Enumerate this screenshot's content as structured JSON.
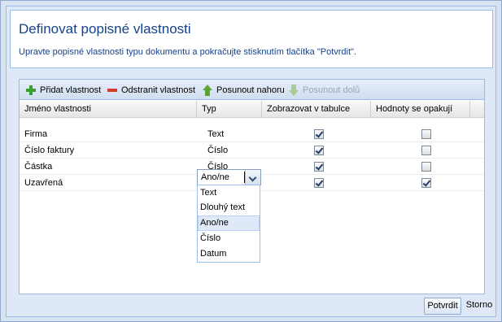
{
  "dialog": {
    "title": "Definovat popisné vlastnosti",
    "description": "Upravte popisné vlastnosti typu dokumentu a pokračujte stisknutím tlačítka \"Potvrdit\"."
  },
  "toolbar": {
    "add_label": "Přidat vlastnost",
    "remove_label": "Odstranit vlastnost",
    "move_up_label": "Posunout nahoru",
    "move_down_label": "Posunout dolů"
  },
  "grid": {
    "columns": [
      "Jméno vlastnosti",
      "Typ",
      "Zobrazovat v tabulce",
      "Hodnoty se opakují"
    ],
    "rows": [
      {
        "name": "Firma",
        "type": "Text",
        "show_in_table": true,
        "repeating": false
      },
      {
        "name": "Číslo faktury",
        "type": "Číslo",
        "show_in_table": true,
        "repeating": false
      },
      {
        "name": "Částka",
        "type": "Číslo",
        "show_in_table": true,
        "repeating": false
      },
      {
        "name": "Uzavřená",
        "type": "Ano/ne",
        "show_in_table": true,
        "repeating": true
      }
    ]
  },
  "type_editor": {
    "value": "Ano/ne",
    "options": [
      "Text",
      "Dlouhý text",
      "Ano/ne",
      "Číslo",
      "Datum"
    ],
    "selected_option": "Ano/ne"
  },
  "footer": {
    "confirm_label": "Potvrdit",
    "cancel_label": "Storno"
  }
}
